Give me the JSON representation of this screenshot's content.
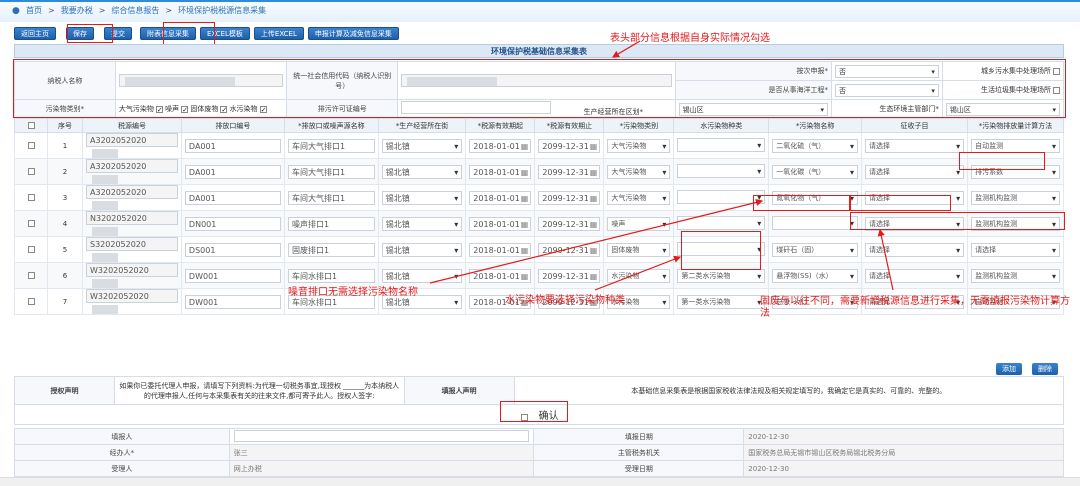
{
  "breadcrumb": [
    "首页",
    "我要办税",
    "综合信息报告",
    "环境保护税税源信息采集"
  ],
  "toolbar": [
    "返回主页",
    "保存",
    "提交",
    "附表信息采集",
    "EXCEL模板",
    "上传EXCEL",
    "申报计算及减免信息采集"
  ],
  "form_title": "环境保护税基础信息采集表",
  "header": {
    "taxpayer_name_label": "纳税人名称",
    "credit_code_label": "统一社会信用代码（纳税人识别号）",
    "by_time_label": "按次申报*",
    "by_time_value": "否",
    "urban_sewage_label": "城乡污水集中处理场所",
    "marine_label": "是否从事海洋工程*",
    "marine_value": "否",
    "garbage_label": "生活垃圾集中处理场所",
    "pollutant_type_label": "污染物类别*",
    "pollutant_types": [
      "大气污染物",
      "噪声",
      "固体废物",
      "水污染物"
    ],
    "permit_label": "排污许可证编号",
    "district_label": "生产经营所在区划*",
    "district_value": "锡山区",
    "env_dept_label": "生态环境主管部门*",
    "env_dept_value": "锡山区"
  },
  "table": {
    "headers": [
      "序号",
      "税源编号",
      "排放口编号",
      "*排放口或噪声源名称",
      "*生产经营所在街",
      "*税源有效期起",
      "*税源有效期止",
      "*污染物类别",
      "水污染物种类",
      "*污染物名称",
      "征收子目",
      "*污染物排放量计算方法"
    ],
    "rows": [
      {
        "no": "1",
        "src": "A3202052020",
        "port": "DA001",
        "name": "车间大气排口1",
        "street": "锡北镇",
        "start": "2018-01-01",
        "end": "2099-12-31",
        "cat": "大气污染物",
        "water": "",
        "pollutant": "二氧化硫（气）",
        "item": "请选择",
        "method": "自动监测"
      },
      {
        "no": "2",
        "src": "A3202052020",
        "port": "DA001",
        "name": "车间大气排口1",
        "street": "锡北镇",
        "start": "2018-01-01",
        "end": "2099-12-31",
        "cat": "大气污染物",
        "water": "",
        "pollutant": "一氧化碳（气）",
        "item": "请选择",
        "method": "排污系数"
      },
      {
        "no": "3",
        "src": "A3202052020",
        "port": "DA001",
        "name": "车间大气排口1",
        "street": "锡北镇",
        "start": "2018-01-01",
        "end": "2099-12-31",
        "cat": "大气污染物",
        "water": "",
        "pollutant": "氮氧化物（气）",
        "item": "请选择",
        "method": "监测机构监测"
      },
      {
        "no": "4",
        "src": "N3202052020",
        "port": "DN001",
        "name": "噪声排口1",
        "street": "锡北镇",
        "start": "2018-01-01",
        "end": "2099-12-31",
        "cat": "噪声",
        "water": "",
        "pollutant": "",
        "item": "请选择",
        "method": "监测机构监测"
      },
      {
        "no": "5",
        "src": "S3202052020",
        "port": "DS001",
        "name": "固废排口1",
        "street": "锡北镇",
        "start": "2018-01-01",
        "end": "2099-12-31",
        "cat": "固体废物",
        "water": "",
        "pollutant": "煤矸石（固）",
        "item": "请选择",
        "method": "请选择"
      },
      {
        "no": "6",
        "src": "W3202052020",
        "port": "DW001",
        "name": "车间水排口1",
        "street": "锡北镇",
        "start": "2018-01-01",
        "end": "2099-12-31",
        "cat": "水污染物",
        "water": "第二类水污染物",
        "pollutant": "悬浮物(SS)（水）",
        "item": "请选择",
        "method": "监测机构监测"
      },
      {
        "no": "7",
        "src": "W3202052020",
        "port": "DW001",
        "name": "车间水排口1",
        "street": "锡北镇",
        "start": "2018-01-01",
        "end": "2099-12-31",
        "cat": "水污染物",
        "water": "第一类水污染物",
        "pollutant": "总汞（水）",
        "item": "请选择",
        "method": "自动监测"
      }
    ]
  },
  "annotations": {
    "header_note": "表头部分信息根据自身实际情况勾选",
    "noise_note": "噪音排口无需选择污染物名称",
    "water_note": "水污染物要选择污染物种类",
    "solid_note": "固废与以往不同，需要新增税源信息进行采集，无需填报污染物计算方法"
  },
  "buttons": {
    "add": "添加",
    "delete": "删除",
    "confirm": "确认"
  },
  "auth": {
    "label": "授权声明",
    "text": "如果你已委托代理人申报，请填写下列资料:为代理一切税务事宜,现授权 ______为本纳税人的代理申报人,任何与本采集表有关的往来文件,都可寄予此人。授权人签字:",
    "filler_label": "填报人声明",
    "filler_text": "本基础信息采集表是根据国家税收法律法规及相关规定填写的，我确定它是真实的、可靠的、完整的。"
  },
  "footer": {
    "filler": "填报人",
    "fill_date_label": "填报日期",
    "fill_date": "2020-12-30",
    "handler": "经办人*",
    "handler_name": "张三",
    "tax_office_label": "主管税务机关",
    "tax_office": "国家税务总局无锡市锡山区税务局锡北税务分局",
    "receiver": "受理人",
    "receiver_name": "网上办税",
    "accept_date_label": "受理日期",
    "accept_date": "2020-12-30"
  }
}
